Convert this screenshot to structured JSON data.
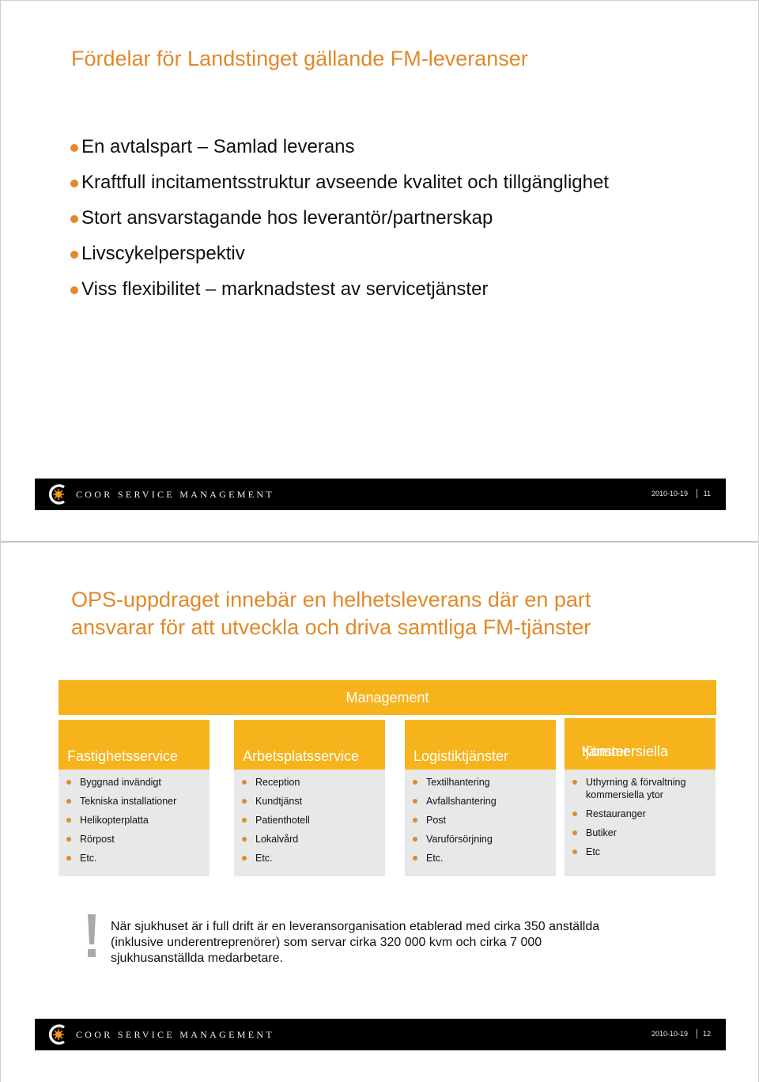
{
  "slides": [
    {
      "title": "Fördelar för Landstinget gällande FM-leveranser",
      "bullets": [
        "En avtalspart – Samlad leverans",
        "Kraftfull incitamentsstruktur avseende kvalitet och tillgänglighet",
        "Stort ansvarstagande hos leverantör/partnerskap",
        "Livscykelperspektiv",
        "Viss flexibilitet – marknadstest av servicetjänster"
      ],
      "footer": {
        "brand": "COOR SERVICE MANAGEMENT",
        "date": "2010-10-19",
        "page": "11",
        "logo_icon": "coor-logo-icon"
      }
    },
    {
      "title_lines": [
        "OPS-uppdraget innebär en helhetsleverans där en part",
        "ansvarar för att utveckla och driva samtliga FM-tjänster"
      ],
      "management_label": "Management",
      "columns": [
        {
          "header_lines": [
            "Fastighetsservice"
          ],
          "items": [
            "Byggnad invändigt",
            "Tekniska installationer",
            "Helikopterplatta",
            "Rörpost",
            "Etc."
          ]
        },
        {
          "header_lines": [
            "Arbetsplatsservice"
          ],
          "items": [
            "Reception",
            "Kundtjänst",
            "Patienthotell",
            "Lokalvård",
            "Etc."
          ]
        },
        {
          "header_lines": [
            "Logistiktjänster"
          ],
          "items": [
            "Textilhantering",
            "Avfallshantering",
            "Post",
            "Varuförsörjning",
            "Etc."
          ]
        },
        {
          "header_lines": [
            "Kommersiella",
            "tjänster"
          ],
          "items": [
            "Uthyrning & förvaltning kommersiella ytor",
            "Restauranger",
            "Butiker",
            "Etc"
          ]
        }
      ],
      "note": {
        "icon": "exclamation-icon",
        "lines": [
          "När sjukhuset är i full drift är en leveransorganisation etablerad med cirka 350 anställda",
          "(inklusive underentreprenörer) som servar cirka 320 000 kvm och cirka 7 000",
          "sjukhusanställda medarbetare."
        ]
      },
      "footer": {
        "brand": "COOR SERVICE MANAGEMENT",
        "date": "2010-10-19",
        "page": "12",
        "logo_icon": "coor-logo-icon"
      }
    }
  ],
  "colors": {
    "title": "#e0892a",
    "accent_box": "#f6b31c",
    "list_bg": "#e8e8e8",
    "bullet": "#e08a2c",
    "footer_bg": "#000000"
  }
}
